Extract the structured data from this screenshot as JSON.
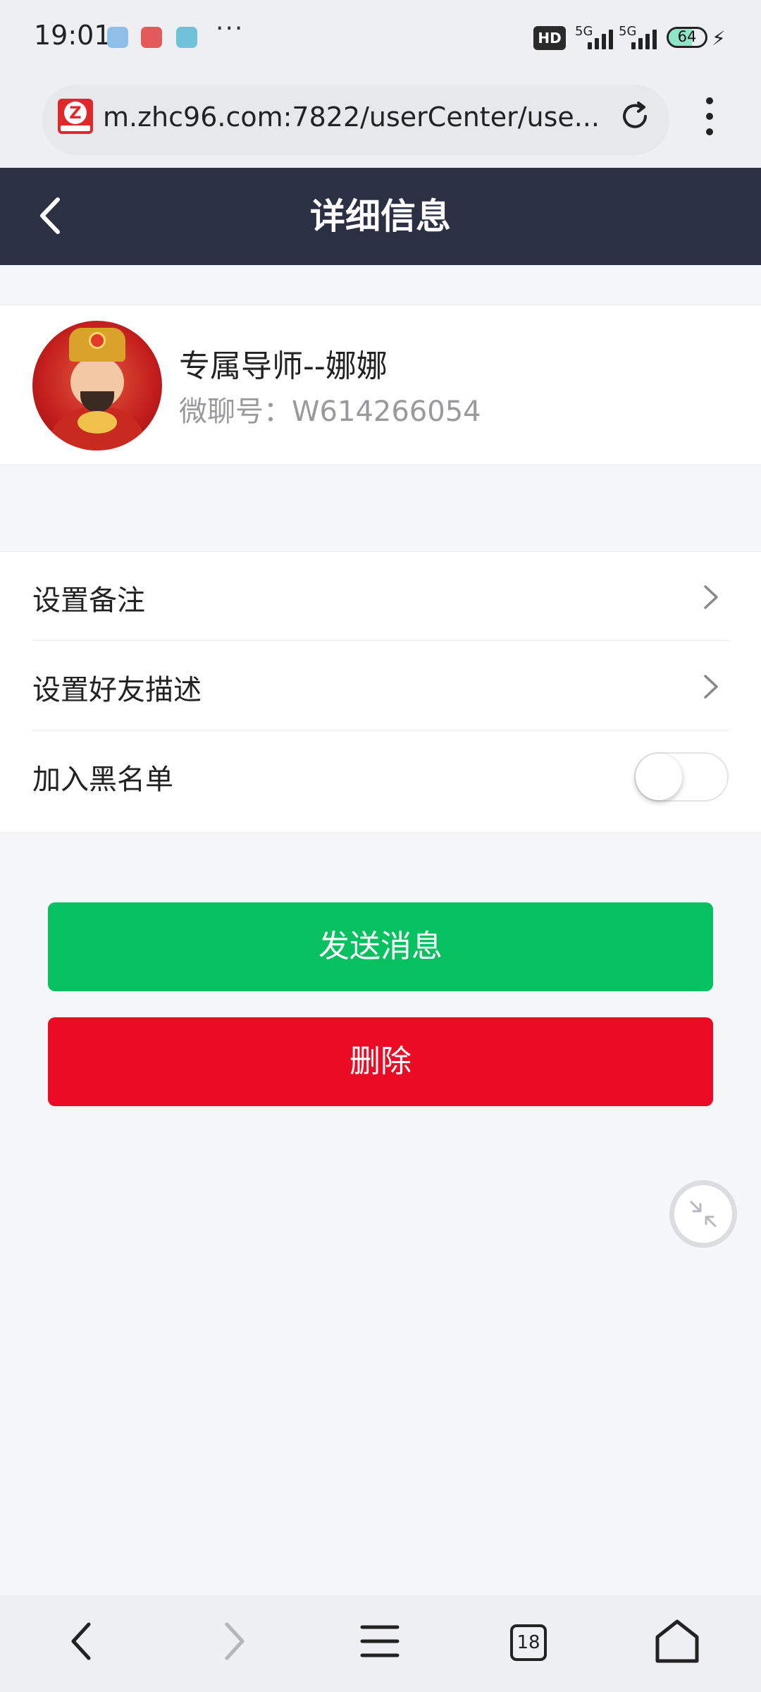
{
  "status_bar": {
    "time": "19:01",
    "dots": "···",
    "hd_badge": "HD",
    "network_1": "5G",
    "network_2": "5G",
    "battery": "64"
  },
  "browser": {
    "url": "m.zhc96.com:7822/userCenter/use..."
  },
  "header": {
    "title": "详细信息"
  },
  "profile": {
    "name": "专属导师--娜娜",
    "id_line": "微聊号：W614266054"
  },
  "settings": {
    "items": [
      {
        "label": "设置备注"
      },
      {
        "label": "设置好友描述"
      },
      {
        "label": "加入黑名单"
      }
    ],
    "blacklist_on": false
  },
  "actions": {
    "send_label": "发送消息",
    "delete_label": "删除"
  },
  "bottom_nav": {
    "tab_count": "18"
  },
  "colors": {
    "header_bg": "#2c3043",
    "send_green": "#07c160",
    "delete_red": "#ec0b24"
  }
}
